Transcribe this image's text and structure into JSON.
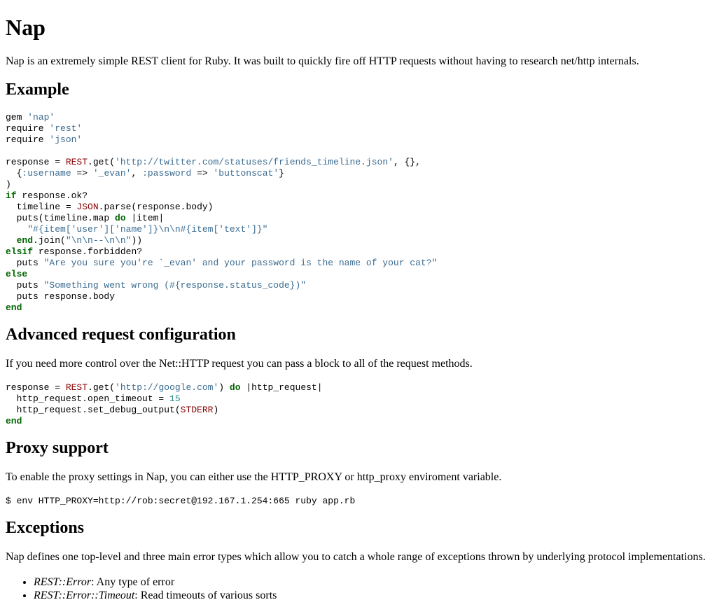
{
  "title": "Nap",
  "intro": "Nap is an extremely simple REST client for Ruby. It was built to quickly fire off HTTP requests without having to research net/http internals.",
  "sections": {
    "example": {
      "heading": "Example",
      "code_header": [
        "gem 'nap'",
        "require 'rest'",
        "require 'json'"
      ],
      "code_body": [
        "response = REST.get('http://twitter.com/statuses/friends_timeline.json', {},",
        "  {:username => '_evan', :password => 'buttonscat'}",
        ")",
        "if response.ok?",
        "  timeline = JSON.parse(response.body)",
        "  puts(timeline.map do |item|",
        "    \"#{item['user']['name']}\\n\\n#{item['text']}\"",
        "  end.join(\"\\n\\n--\\n\\n\"))",
        "elsif response.forbidden?",
        "  puts \"Are you sure you're `_evan' and your password is the name of your cat?\"",
        "else",
        "  puts \"Something went wrong (#{response.status_code})\"",
        "  puts response.body",
        "end"
      ]
    },
    "advanced": {
      "heading": "Advanced request configuration",
      "text": "If you need more control over the Net::HTTP request you can pass a block to all of the request methods.",
      "code": [
        "response = REST.get('http://google.com') do |http_request|",
        "  http_request.open_timeout = 15",
        "  http_request.set_debug_output(STDERR)",
        "end"
      ]
    },
    "proxy": {
      "heading": "Proxy support",
      "text": "To enable the proxy settings in Nap, you can either use the HTTP_PROXY or http_proxy enviroment variable.",
      "code": "$ env HTTP_PROXY=http://rob:secret@192.167.1.254:665 ruby app.rb"
    },
    "exceptions": {
      "heading": "Exceptions",
      "text": "Nap defines one top-level and three main error types which allow you to catch a whole range of exceptions thrown by underlying protocol implementations.",
      "items": [
        {
          "name": "REST::Error",
          "desc": ": Any type of error"
        },
        {
          "name": "REST::Error::Timeout",
          "desc": ": Read timeouts of various sorts"
        }
      ]
    }
  },
  "colors": {
    "keyword": "#006600",
    "string": "#3b6c91",
    "constant": "#880000",
    "number": "#2a8a8a"
  }
}
